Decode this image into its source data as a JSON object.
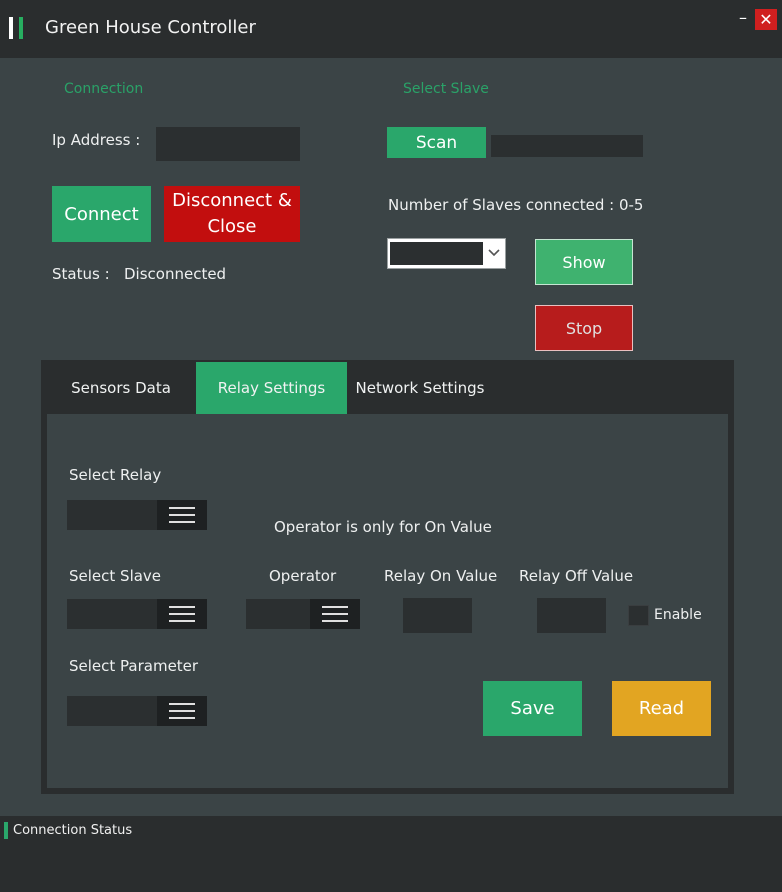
{
  "window": {
    "title": "Green House Controller",
    "minimize_glyph": "–",
    "close_glyph": "✕"
  },
  "connection": {
    "section_label": "Connection",
    "ip_label": "Ip Address  :",
    "ip_value": "",
    "connect_label": "Connect",
    "disconnect_line1": "Disconnect &",
    "disconnect_line2": "Close",
    "status_label": "Status  :",
    "status_value": "Disconnected"
  },
  "slave": {
    "section_label": "Select Slave",
    "scan_label": "Scan",
    "scan_result": "",
    "count_label": "Number of Slaves connected :",
    "count_value": "0-5",
    "selected_slave": "",
    "show_label": "Show",
    "stop_label": "Stop"
  },
  "tabs": [
    {
      "label": "Sensors Data",
      "active": false
    },
    {
      "label": "Relay Settings",
      "active": true
    },
    {
      "label": "Network Settings",
      "active": false
    }
  ],
  "relay": {
    "select_relay_label": "Select Relay",
    "operator_note": "Operator is only for On Value",
    "select_slave_label": "Select Slave",
    "operator_label": "Operator",
    "relay_on_label": "Relay On Value",
    "relay_off_label": "Relay Off Value",
    "relay_on_value": "",
    "relay_off_value": "",
    "enable_label": "Enable",
    "enable_checked": false,
    "select_parameter_label": "Select Parameter",
    "save_label": "Save",
    "read_label": "Read"
  },
  "statusbar": {
    "text": "Connection Status"
  },
  "colors": {
    "accent_green": "#2aa76b",
    "danger_red": "#c20e0e",
    "read_orange": "#e2a522",
    "background": "#3b4446",
    "dark_panel": "#2a2d2e"
  }
}
